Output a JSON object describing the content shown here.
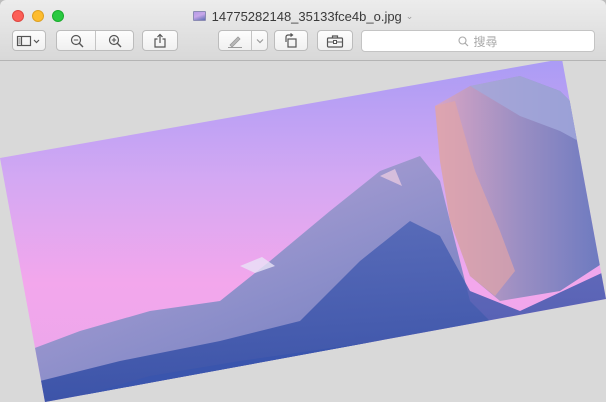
{
  "window": {
    "filename": "14775282148_35133fce4b_o.jpg"
  },
  "toolbar": {
    "sidebar_button": "sidebar-icon",
    "zoom_out_button": "zoom-out-icon",
    "zoom_in_button": "zoom-in-icon",
    "share_button": "share-icon",
    "markup_button": "pen-icon",
    "rotate_button": "rotate-left-icon",
    "toolbox_button": "toolbox-icon",
    "search_placeholder": "搜尋"
  },
  "colors": {
    "close": "#fc5f57",
    "minimize": "#fdbc2e",
    "maximize": "#29c940",
    "sky_top": "#b79cf2",
    "sky_pink": "#f2a5ea",
    "rock": "#7b88c8"
  },
  "image": {
    "rotation_degrees": -20,
    "subject": "Half Dome, Yosemite at dusk"
  }
}
